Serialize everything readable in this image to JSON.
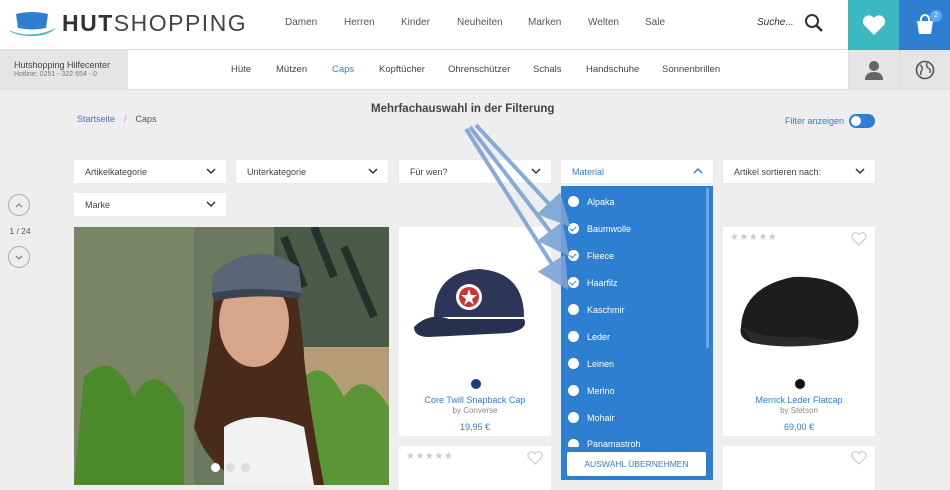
{
  "header": {
    "logo_text_bold": "HUT",
    "logo_text_rest": "SHOPPING",
    "nav": [
      "Damen",
      "Herren",
      "Kinder",
      "Neuheiten",
      "Marken",
      "Welten",
      "Sale"
    ],
    "search_placeholder": "Suche...",
    "cart_count": "2"
  },
  "subbar": {
    "help_title": "Hutshopping Hilfecenter",
    "help_hotline": "Hotline: 0251 - 322 654 - 0",
    "categories": [
      "Hüte",
      "Mützen",
      "Caps",
      "Kopftücher",
      "Ohrenschützer",
      "Schals",
      "Handschuhe",
      "Sonnenbrillen"
    ],
    "active_category": "Caps"
  },
  "breadcrumb": {
    "home": "Startseite",
    "separator": "/",
    "current": "Caps"
  },
  "annotation": "Mehrfachauswahl in der Filterung",
  "filter_toggle_label": "Filter anzeigen",
  "filters": [
    "Artikelkategorie",
    "Unterkategorie",
    "Für wen?",
    "Material",
    "Artikel sortieren nach:",
    "Marke"
  ],
  "pager": {
    "label": "1 / 24"
  },
  "material_options": [
    {
      "label": "Alpaka",
      "checked": false
    },
    {
      "label": "Baumwolle",
      "checked": true
    },
    {
      "label": "Fleece",
      "checked": true
    },
    {
      "label": "Haarfilz",
      "checked": true
    },
    {
      "label": "Kaschmir",
      "checked": false
    },
    {
      "label": "Leder",
      "checked": false
    },
    {
      "label": "Leinen",
      "checked": false
    },
    {
      "label": "Merino",
      "checked": false
    },
    {
      "label": "Mohair",
      "checked": false
    },
    {
      "label": "Panamastroh",
      "checked": false
    }
  ],
  "apply_button": "AUSWAHL ÜBERNEHMEN",
  "products": [
    {
      "name": "Core Twill Snapback Cap",
      "brand": "by Converse",
      "price": "19,95 €",
      "color": "#1a3a8a"
    },
    {
      "name": "Merrick Leder Flatcap",
      "brand": "by Stetson",
      "price": "69,00 €",
      "color": "#111111"
    }
  ],
  "colors": {
    "accent": "#2e7fd1",
    "teal": "#3cb8c2"
  }
}
